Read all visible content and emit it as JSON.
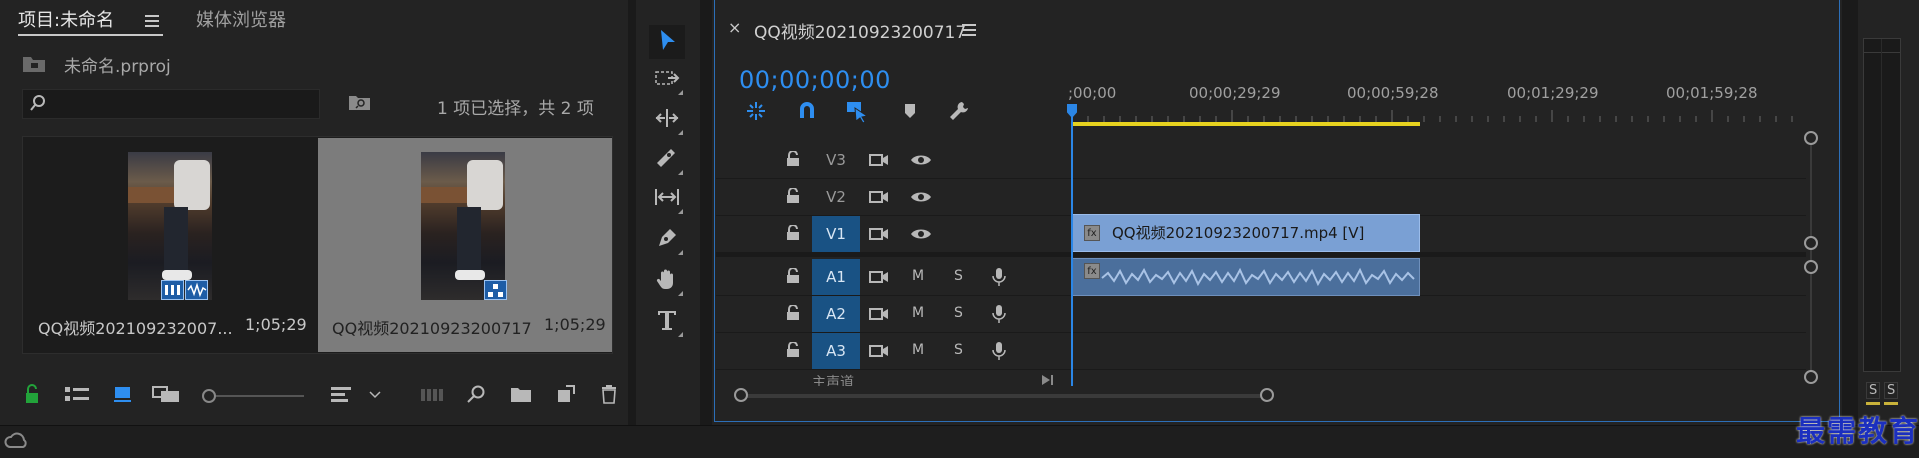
{
  "project_panel": {
    "tabs": [
      {
        "label": "项目:未命名",
        "active": true
      },
      {
        "label": "媒体浏览器",
        "active": false
      }
    ],
    "project_file": "未命名.prproj",
    "search_placeholder": "",
    "selection_status": "1 项已选择，共 2 项",
    "items": [
      {
        "name": "QQ视频202109232007...",
        "duration": "1;05;29",
        "selected": false
      },
      {
        "name": "QQ视频20210923200717",
        "duration": "1;05;29",
        "selected": true
      }
    ]
  },
  "tools": [
    {
      "name": "selection-tool",
      "active": true
    },
    {
      "name": "track-select-forward-tool",
      "active": false
    },
    {
      "name": "ripple-edit-tool",
      "active": false
    },
    {
      "name": "razor-tool",
      "active": false
    },
    {
      "name": "slip-tool",
      "active": false
    },
    {
      "name": "pen-tool",
      "active": false
    },
    {
      "name": "hand-tool",
      "active": false
    },
    {
      "name": "type-tool",
      "active": false
    }
  ],
  "timeline": {
    "sequence_name": "QQ视频20210923200717",
    "timecode": "00;00;00;00",
    "ruler_labels": [
      ";00;00",
      "00;00;29;29",
      "00;00;59;28",
      "00;01;29;29",
      "00;01;59;28"
    ],
    "video_tracks": [
      {
        "name": "V3",
        "targeted": false
      },
      {
        "name": "V2",
        "targeted": false
      },
      {
        "name": "V1",
        "targeted": true
      }
    ],
    "audio_tracks": [
      {
        "name": "A1",
        "targeted": true,
        "mute": "M",
        "solo": "S"
      },
      {
        "name": "A2",
        "targeted": true,
        "mute": "M",
        "solo": "S"
      },
      {
        "name": "A3",
        "targeted": true,
        "mute": "M",
        "solo": "S"
      }
    ],
    "master_track_label": "主声道",
    "video_clip_label": "QQ视频20210923200717.mp4 [V]",
    "fx_label": "fx"
  },
  "meters": {
    "solo_left": "S",
    "solo_right": "S"
  },
  "watermark": "最需教育",
  "colors": {
    "accent_blue": "#2e8ef0",
    "targeted_track": "#195284",
    "video_clip": "#7aa0d4",
    "audio_clip": "#4b6f9c",
    "work_area": "#e7d21f",
    "panel_bg": "#232323"
  }
}
